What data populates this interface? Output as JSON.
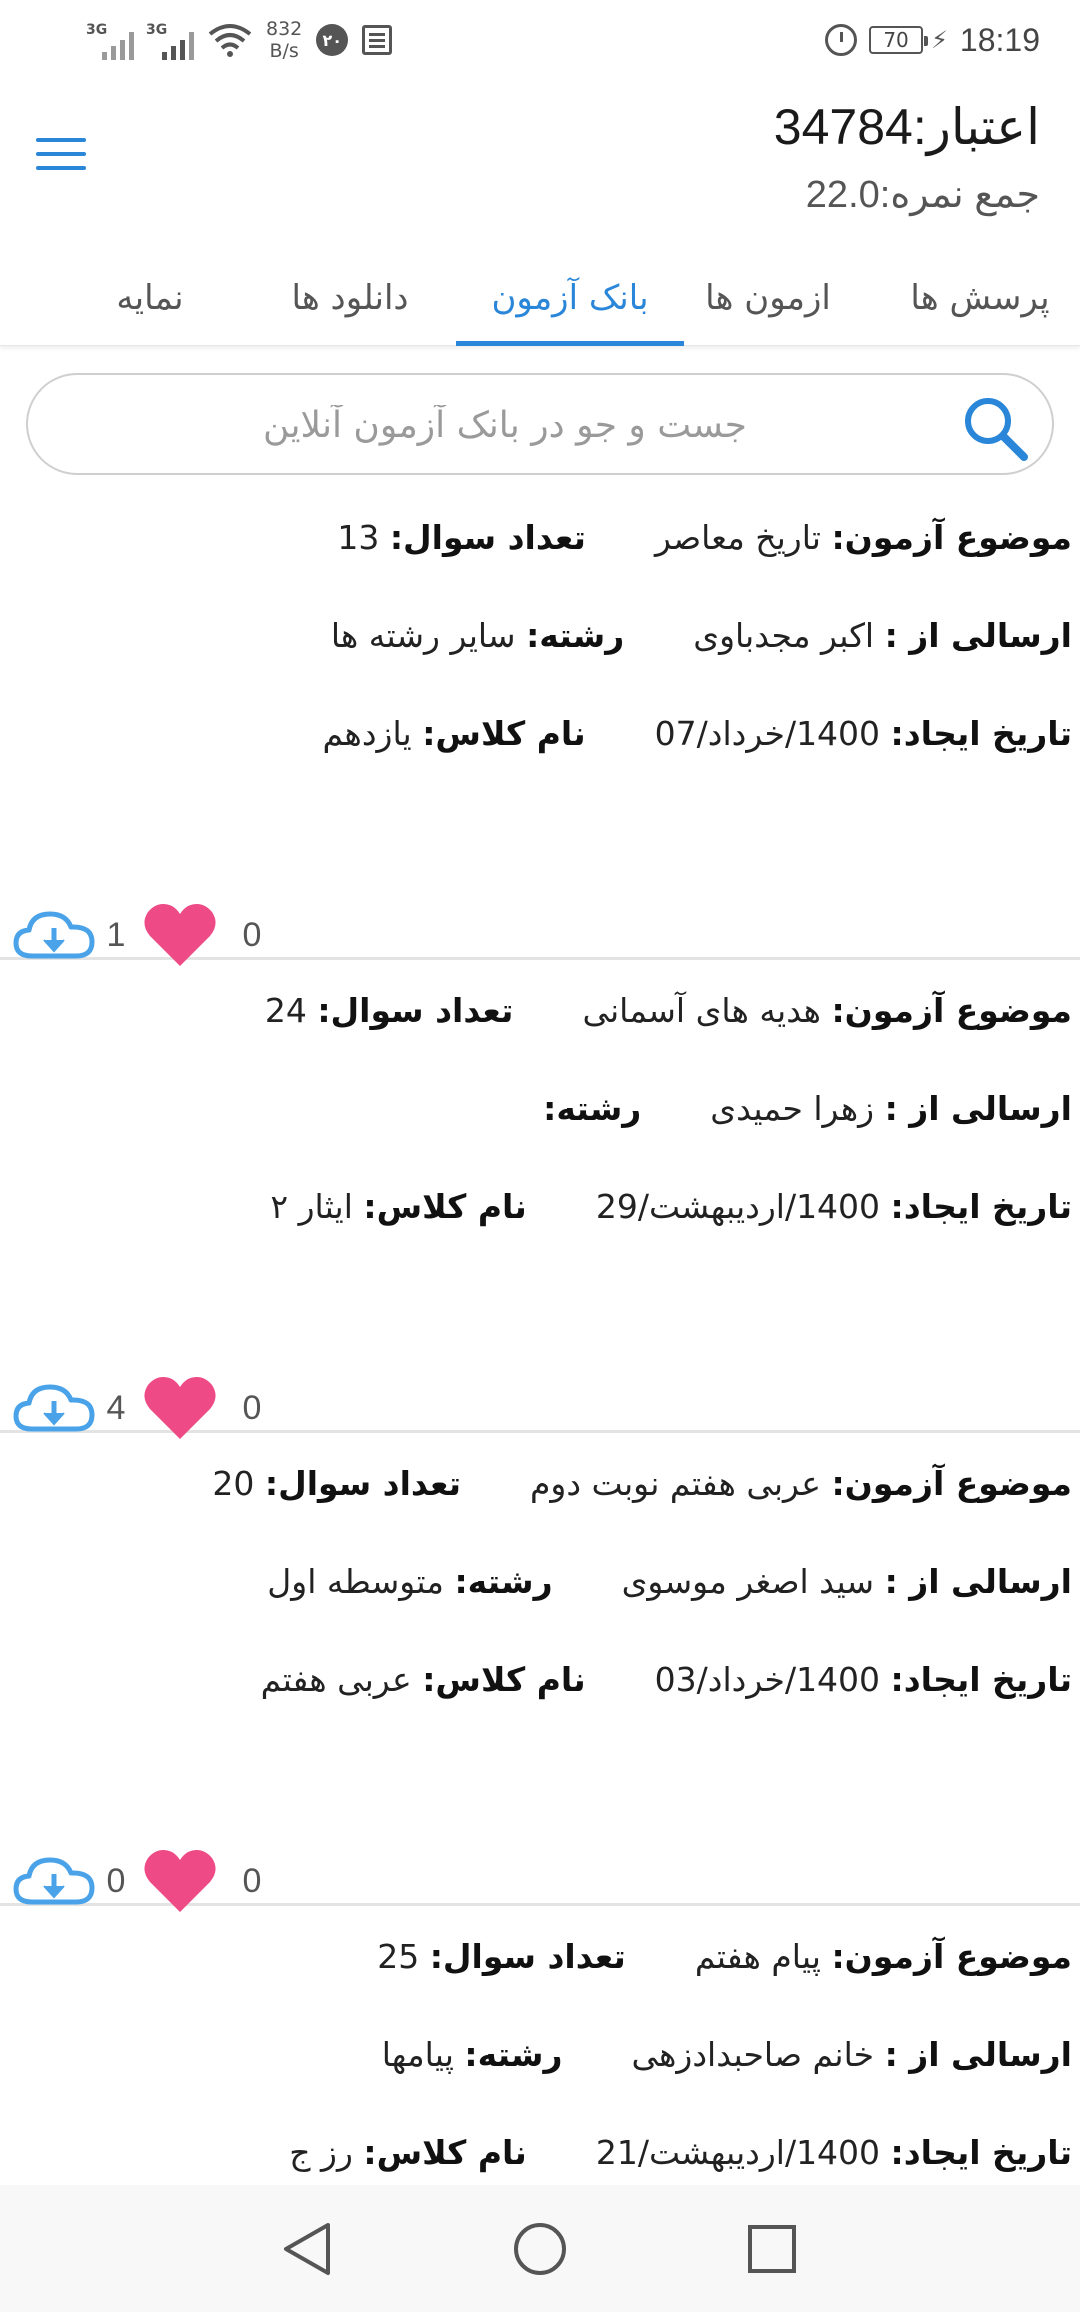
{
  "status_bar": {
    "network_1": "3G",
    "network_2": "3G",
    "net_speed_value": "832",
    "net_speed_unit": "B/s",
    "notification_badge": "۲۰",
    "battery": "70",
    "time": "18:19"
  },
  "header": {
    "credit": "اعتبار:34784",
    "total_score": "جمع نمره:22.0",
    "menu_icon": "hamburger-menu-icon"
  },
  "tabs": [
    {
      "label": "پرسش ها",
      "active": false
    },
    {
      "label": "ازمون ها",
      "active": false
    },
    {
      "label": "بانک آزمون",
      "active": true
    },
    {
      "label": "دانلود ها",
      "active": false
    },
    {
      "label": "نمایه",
      "active": false
    }
  ],
  "search": {
    "placeholder": "جست و جو در بانک آزمون آنلاین",
    "icon": "search-icon"
  },
  "labels": {
    "subject": "موضوع آزمون:",
    "question_count": "تعداد سوال:",
    "sender": "ارسالی از :",
    "field": "رشته:",
    "created": "تاریخ ایجاد:",
    "class_name": "نام کلاس:"
  },
  "exams": [
    {
      "subject": "تاریخ معاصر",
      "question_count": "13",
      "sender": "اکبر مجدباوی",
      "field": "سایر رشته ها",
      "created": "1400/خرداد/07",
      "class_name": "یازدهم",
      "downloads": "1",
      "likes": "0"
    },
    {
      "subject": "هدیه های آسمانی",
      "question_count": "24",
      "sender": "زهرا حمیدی",
      "field": "",
      "created": "1400/اردیبهشت/29",
      "class_name": "ایثار ۲",
      "downloads": "4",
      "likes": "0"
    },
    {
      "subject": "عربی هفتم نوبت دوم",
      "question_count": "20",
      "sender": "سید اصغر موسوی",
      "field": "متوسطه اول",
      "created": "1400/خرداد/03",
      "class_name": "عربی هفتم",
      "downloads": "0",
      "likes": "0"
    },
    {
      "subject": "پیام هفتم",
      "question_count": "25",
      "sender": "خانم صاحبدادزهی",
      "field": "پیامها",
      "created": "1400/اردیبهشت/21",
      "class_name": "رز ج",
      "downloads": "",
      "likes": ""
    }
  ],
  "colors": {
    "accent": "#2a86d8",
    "heart": "#ee4a86",
    "cloud": "#4aa3e8"
  }
}
